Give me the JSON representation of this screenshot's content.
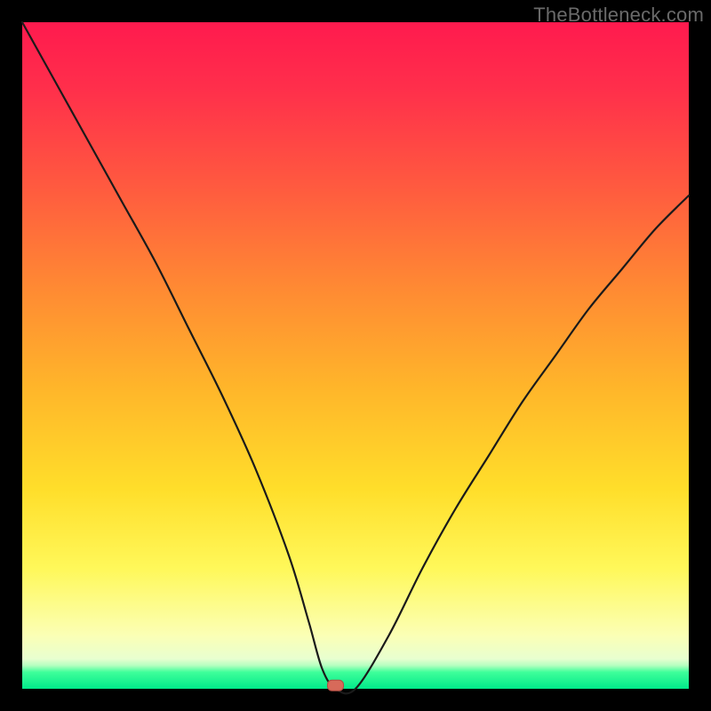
{
  "watermark_text": "TheBottleneck.com",
  "chart_data": {
    "type": "line",
    "title": "",
    "xlabel": "",
    "ylabel": "",
    "xlim": [
      0,
      100
    ],
    "ylim": [
      0,
      100
    ],
    "grid": false,
    "legend": false,
    "series": [
      {
        "name": "bottleneck-curve",
        "x": [
          0,
          5,
          10,
          15,
          20,
          25,
          30,
          35,
          40,
          43,
          45,
          47,
          50,
          55,
          60,
          65,
          70,
          75,
          80,
          85,
          90,
          95,
          100
        ],
        "values": [
          100,
          91,
          82,
          73,
          64,
          54,
          44,
          33,
          20,
          10,
          3,
          0,
          0,
          8,
          18,
          27,
          35,
          43,
          50,
          57,
          63,
          69,
          74
        ]
      }
    ],
    "marker": {
      "x": 47,
      "y": 0.5
    },
    "gradient_stops": [
      {
        "pct": 0,
        "color": "#ff1a4e"
      },
      {
        "pct": 25,
        "color": "#ff5b3f"
      },
      {
        "pct": 55,
        "color": "#ffb62a"
      },
      {
        "pct": 82,
        "color": "#fff85a"
      },
      {
        "pct": 96,
        "color": "#b5ffc0"
      },
      {
        "pct": 100,
        "color": "#00e98a"
      }
    ]
  }
}
